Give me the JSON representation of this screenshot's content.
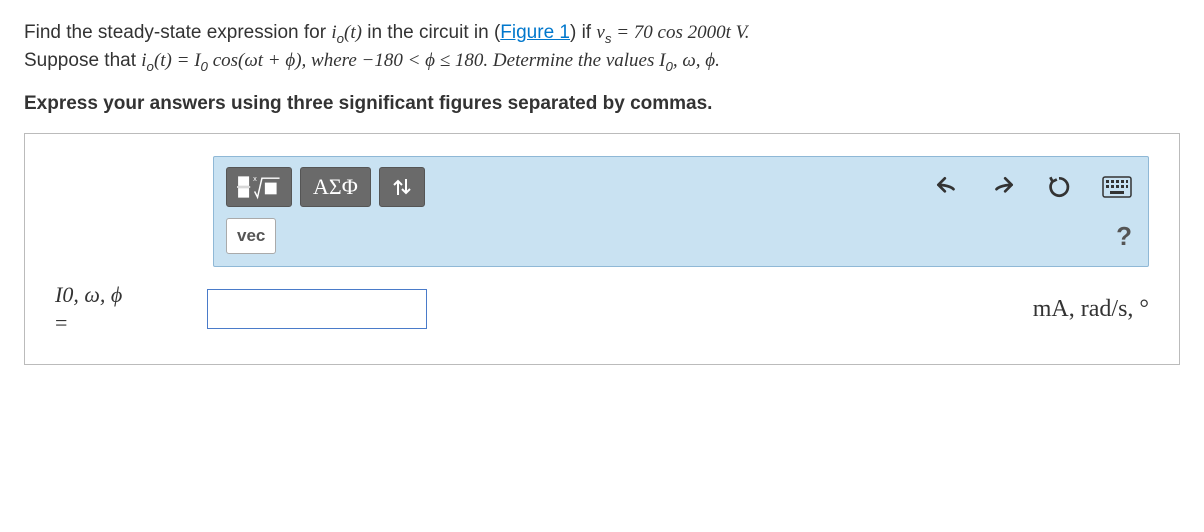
{
  "problem": {
    "line1_a": "Find the steady-state expression for ",
    "io_t": "i",
    "io_sub": "o",
    "io_paren": "(t)",
    "line1_b": " in the circuit in (",
    "figure_link": "Figure 1",
    "line1_c": ") if ",
    "vs": "v",
    "vs_sub": "s",
    "eq70": " = 70 cos 2000t V.",
    "line2_a": "Suppose that ",
    "line2_b": " = I",
    "I0_sub": "0",
    "line2_c": " cos(ωt + ϕ), where −180 < ϕ ≤ 180. Determine the values ",
    "I0": "I",
    "line2_d": ", ω, ϕ."
  },
  "instruction": "Express your answers using three significant figures separated by commas.",
  "toolbar": {
    "greek_label": "ΑΣΦ",
    "vec_label": "vec",
    "help_label": "?"
  },
  "answer": {
    "label_line1": "I",
    "label_sub": "0",
    "label_line1b": ", ω, ϕ",
    "label_line2": "=",
    "units": "mA, rad/s, °"
  }
}
